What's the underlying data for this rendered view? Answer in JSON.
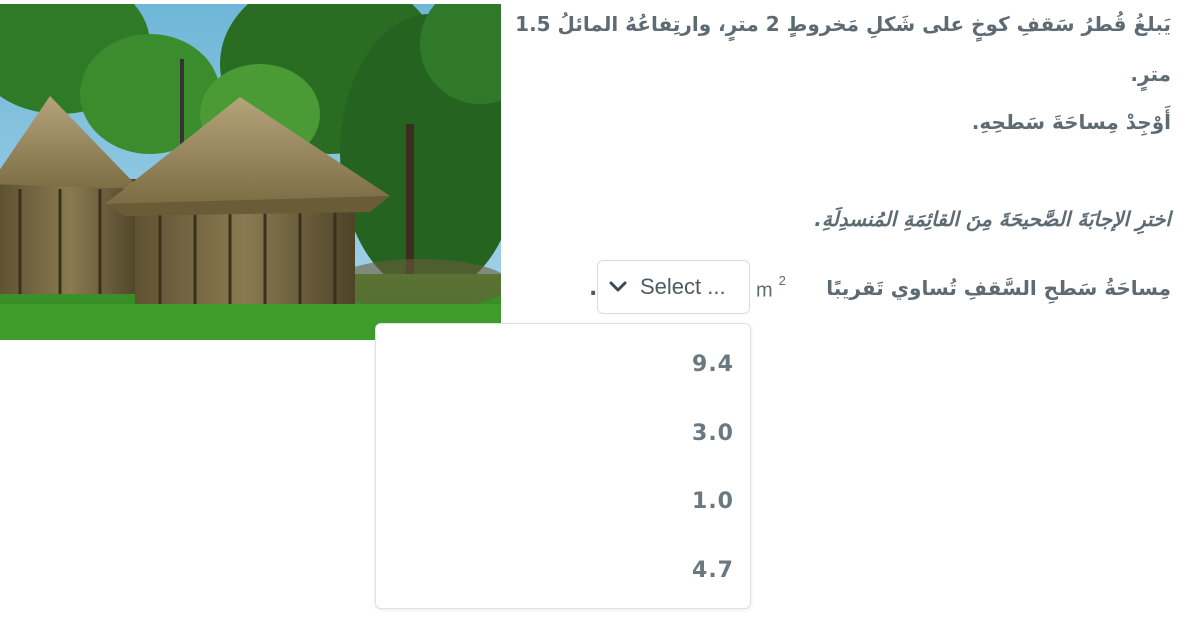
{
  "question": {
    "line1": "يَبلغُ قُطرُ سَقفِ كوخٍ على شَكلِ مَخروطٍ 2 مترٍ، وارتِفاعُهُ المائلُ 1.5",
    "line2": "مترٍ.",
    "line3": "أَوْجِدْ مِساحَةَ سَطحِهِ."
  },
  "instruction": "اخترِ الإجابَةَ الصَّحيحَةَ مِنَ القائِمَةِ المُنسدِلَةِ.",
  "statement": {
    "text": "مِساحَةُ سَطحِ السَّقفِ تُساوي تَقريبًا",
    "unit": "m",
    "unit_exponent": "2",
    "period": "."
  },
  "select": {
    "placeholder": "Select ...",
    "icon": "chevron-down-icon"
  },
  "dropdown": {
    "options": [
      "9.4",
      "3.0",
      "1.0",
      "4.7"
    ]
  },
  "image": {
    "subject": "thatched conical huts"
  }
}
